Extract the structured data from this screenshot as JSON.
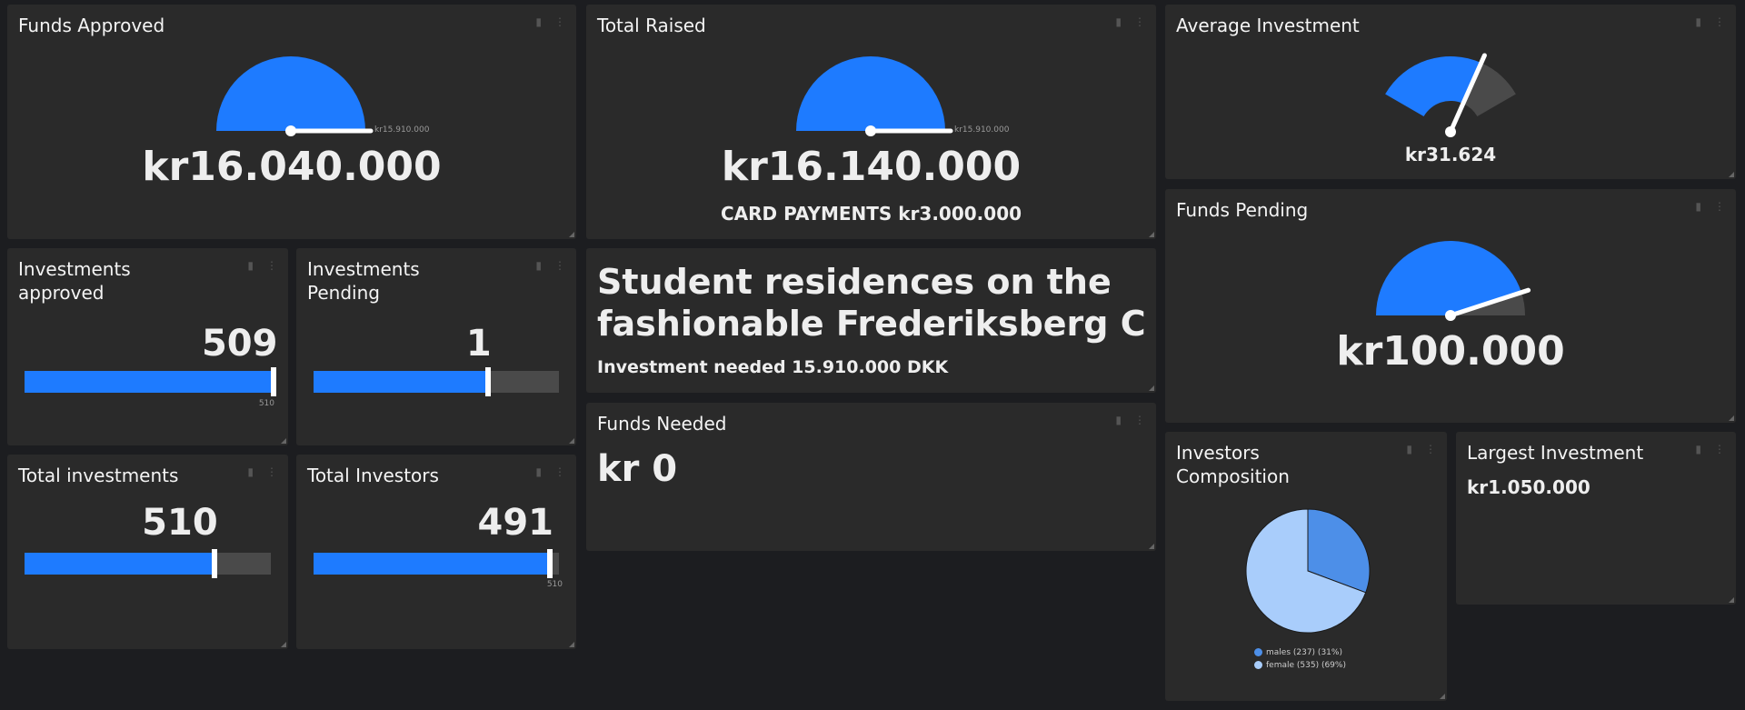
{
  "colors": {
    "accent": "#1e7bff",
    "track": "#4a4a4a",
    "male": "#4d8fe8",
    "female": "#a9cdfb",
    "panel": "#2a2a2a",
    "background": "#1c1d20"
  },
  "icons": [
    "comment-icon",
    "more-vertical-icon",
    "resize-handle-icon"
  ],
  "funds_approved": {
    "title": "Funds Approved",
    "value": "kr16.040.000",
    "max_label": "kr15.910.000",
    "gauge_fraction": 1.0
  },
  "total_raised": {
    "title": "Total Raised",
    "value": "kr16.140.000",
    "max_label": "kr15.910.000",
    "gauge_fraction": 1.0,
    "subtitle": "CARD PAYMENTS kr3.000.000"
  },
  "average_investment": {
    "title": "Average Investment",
    "value": "kr31.624",
    "gauge_fraction": 0.7
  },
  "funds_pending": {
    "title": "Funds Pending",
    "value": "kr100.000",
    "gauge_fraction": 0.9
  },
  "investments_approved": {
    "title": "Investments approved",
    "value": "509",
    "max_label": "510",
    "fill": 0.998
  },
  "investments_pending": {
    "title": "Investments Pending",
    "value": "1",
    "fill": 0.71
  },
  "total_investments": {
    "title": "Total investments",
    "value": "510",
    "fill": 0.77
  },
  "total_investors": {
    "title": "Total Investors",
    "value": "491",
    "max_label": "510",
    "fill": 0.963
  },
  "project": {
    "title_line1": "Student residences on the",
    "title_line2": "fashionable Frederiksberg C",
    "subtitle": "Investment needed 15.910.000 DKK"
  },
  "funds_needed": {
    "title": "Funds Needed",
    "value": "kr 0"
  },
  "investors_composition": {
    "title": "Investors Composition",
    "legend": [
      {
        "label": "males (237) (31%)"
      },
      {
        "label": "female (535) (69%)"
      }
    ]
  },
  "largest_investment": {
    "title": "Largest Investment",
    "value": "kr1.050.000"
  },
  "chart_data": {
    "type": "pie",
    "categories": [
      "males",
      "female"
    ],
    "values": [
      237,
      535
    ],
    "percentages": [
      31,
      69
    ],
    "legend": [
      "males (237) (31%)",
      "female (535) (69%)"
    ]
  }
}
